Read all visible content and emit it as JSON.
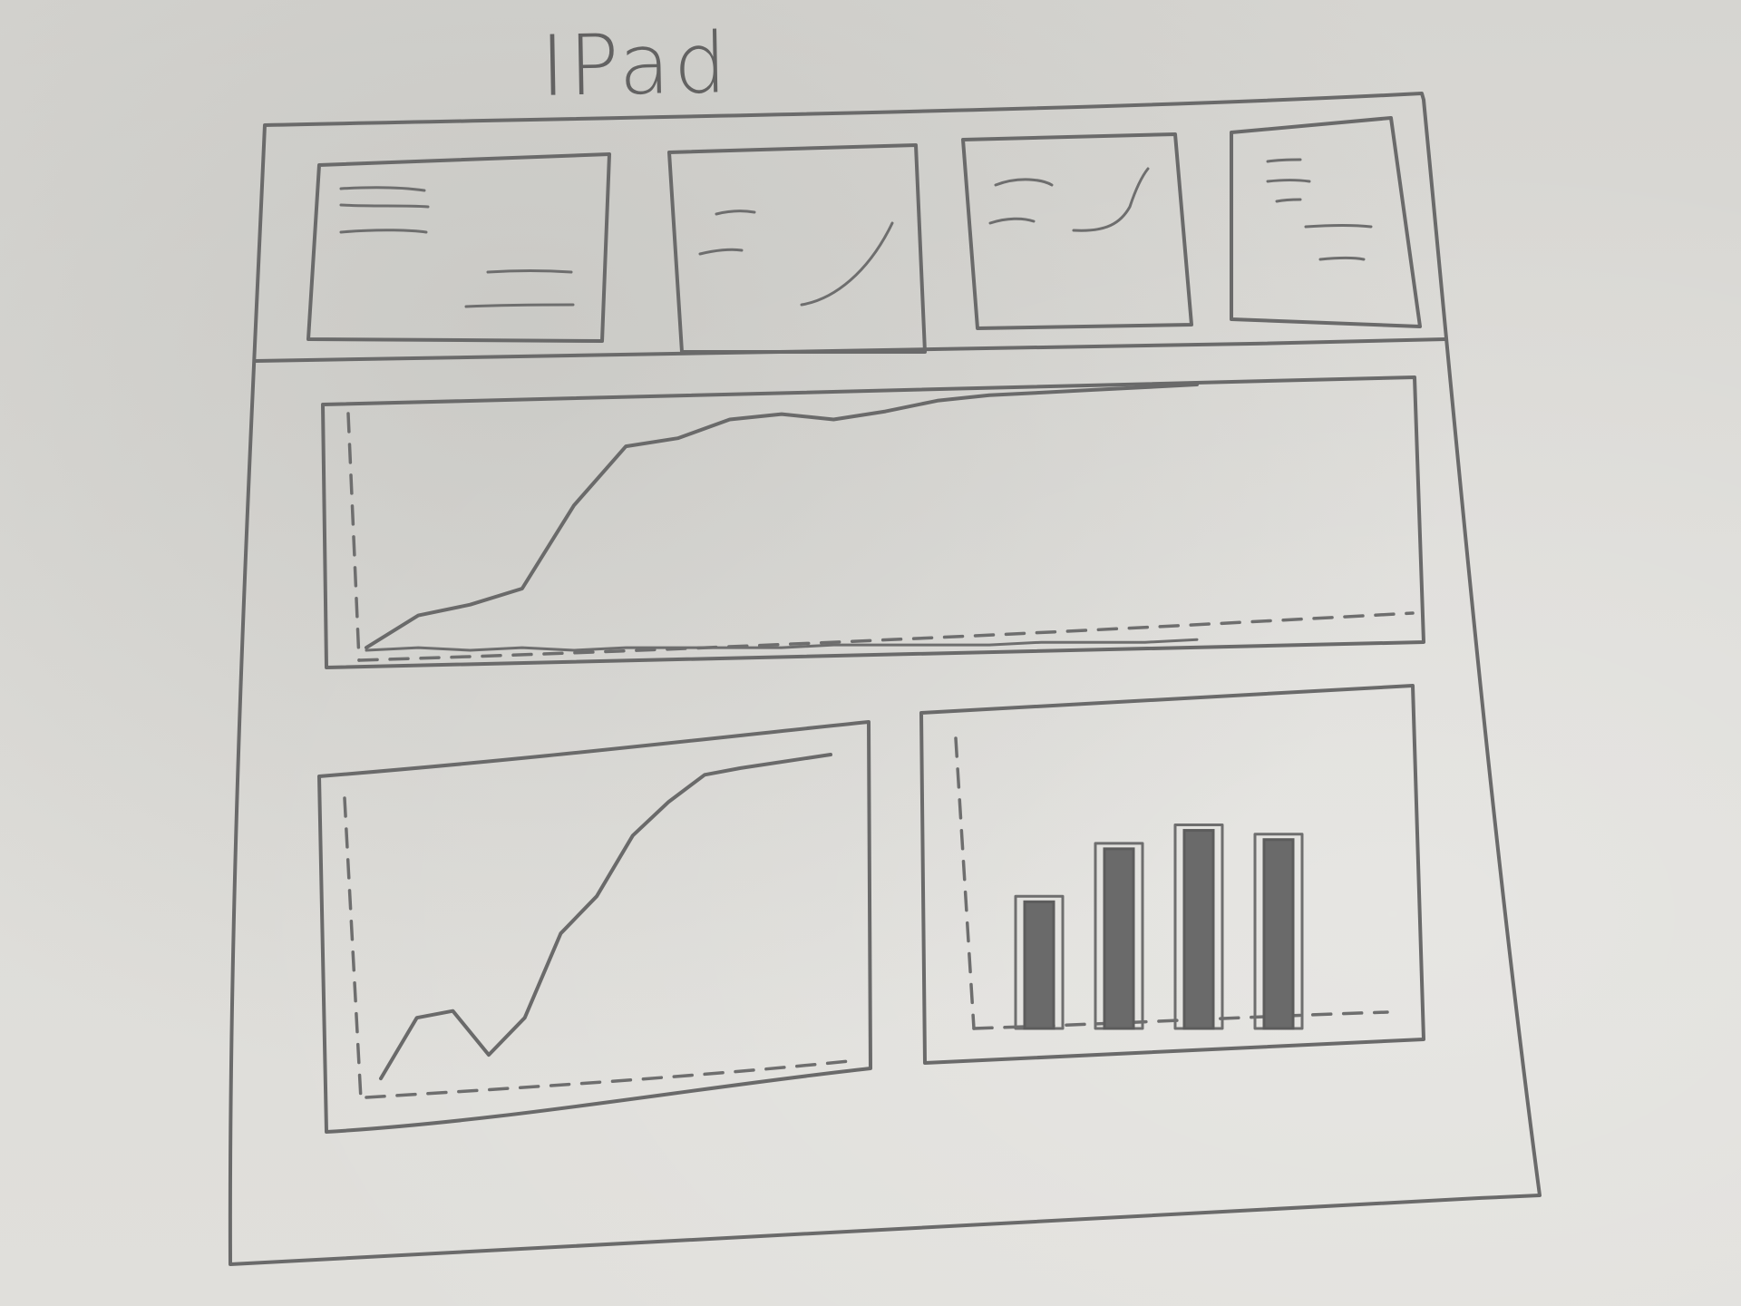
{
  "title": "IPad",
  "colors": {
    "paper": "#d9d8d4",
    "pencil": "#6a6a6a"
  },
  "kpi_cards": [
    {
      "name": "kpi-card-1",
      "icon": "text-lines-icon"
    },
    {
      "name": "kpi-card-2",
      "icon": "sparkline-icon"
    },
    {
      "name": "kpi-card-3",
      "icon": "sparkline-icon"
    },
    {
      "name": "kpi-card-4",
      "icon": "text-lines-icon"
    }
  ],
  "chart_data": [
    {
      "type": "line",
      "x": [
        0,
        0.05,
        0.1,
        0.15,
        0.2,
        0.25,
        0.3,
        0.35,
        0.4,
        0.45,
        0.5,
        0.55,
        0.6,
        0.65,
        0.7,
        0.75,
        0.8
      ],
      "series": [
        {
          "values": [
            2,
            14,
            18,
            24,
            55,
            77,
            80,
            87,
            89,
            87,
            90,
            94,
            96,
            97,
            98,
            99,
            100
          ]
        },
        {
          "values": [
            1,
            2,
            1,
            2,
            1,
            2,
            2,
            2,
            2,
            3,
            3,
            3,
            3,
            4,
            4,
            4,
            5
          ]
        }
      ]
    },
    {
      "type": "line",
      "x": [
        0,
        0.08,
        0.16,
        0.24,
        0.32,
        0.4,
        0.48,
        0.56,
        0.64,
        0.72,
        0.8,
        1
      ],
      "series": [
        {
          "values": [
            4,
            22,
            24,
            11,
            22,
            47,
            58,
            76,
            86,
            94,
            96,
            100
          ]
        }
      ]
    },
    {
      "type": "bar",
      "categories": [
        "1",
        "2",
        "3",
        "4"
      ],
      "values": [
        55,
        78,
        86,
        82
      ],
      "ylim": [
        0,
        100
      ]
    }
  ]
}
